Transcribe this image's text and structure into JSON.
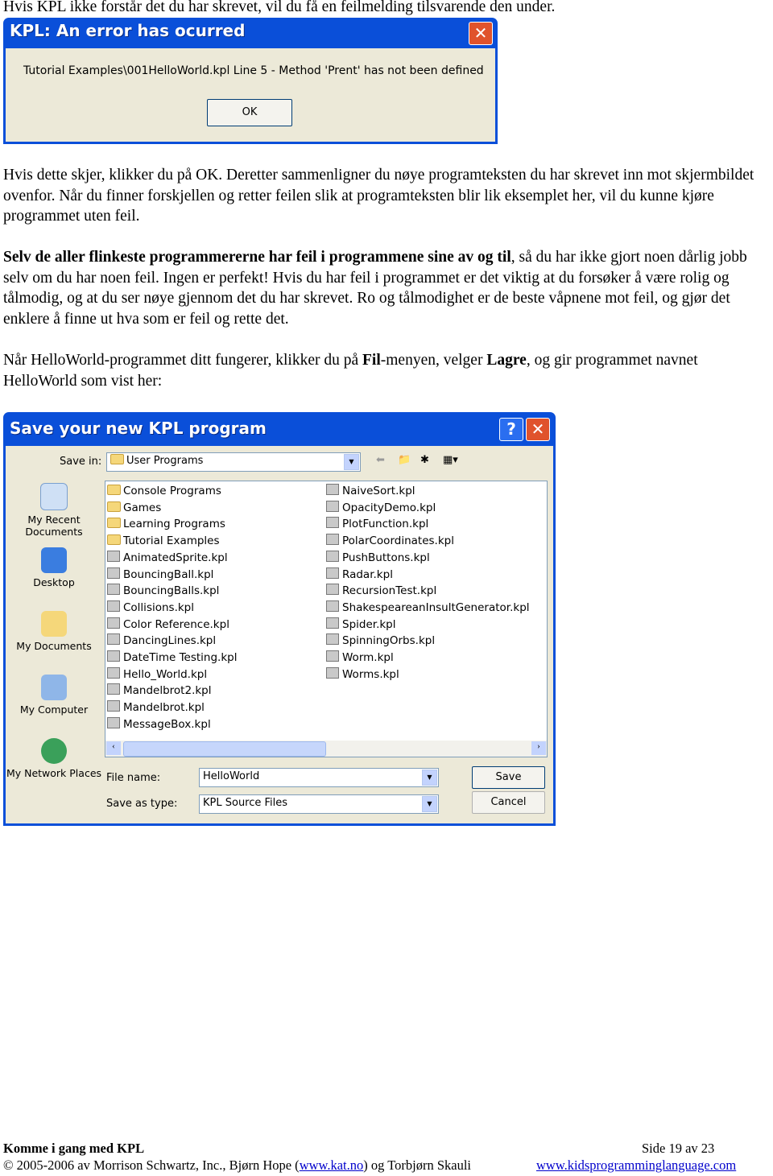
{
  "intro": "Hvis KPL ikke forstår det du har skrevet, vil du få en feilmelding tilsvarende den under.",
  "error_dialog": {
    "title": "KPL: An error has ocurred",
    "message": "Tutorial Examples\\001HelloWorld.kpl Line 5 - Method 'Prent' has not been defined",
    "ok": "OK",
    "close_icon": "close-icon"
  },
  "para1": "Hvis dette skjer, klikker du på OK. Deretter sammenligner du nøye programteksten du har skrevet inn mot skjermbildet ovenfor. Når du finner forskjellen og retter feilen slik at programteksten blir lik eksemplet her, vil du kunne kjøre programmet uten feil.",
  "para2": {
    "bold": "Selv de aller flinkeste programmererne har feil i programmene sine av og til",
    "rest": ", så du har ikke gjort noen dårlig jobb selv om du har noen feil. Ingen er perfekt! Hvis du har feil i programmet er det viktig at du forsøker å være rolig og tålmodig, og at du ser nøye gjennom det du har skrevet. Ro og tålmodighet er de beste våpnene mot feil, og gjør det enklere å finne ut hva som er feil og rette det."
  },
  "para3": {
    "t1": "Når HelloWorld-programmet ditt fungerer, klikker du på ",
    "b1": "Fil",
    "t2": "-menyen, velger ",
    "b2": "Lagre",
    "t3": ", og gir programmet navnet HelloWorld som vist her:"
  },
  "save_dialog": {
    "title": "Save your new KPL program",
    "save_in_label": "Save in:",
    "save_in_value": "User Programs",
    "places": [
      "My Recent Documents",
      "Desktop",
      "My Documents",
      "My Computer",
      "My Network Places"
    ],
    "folders": [
      "Console Programs",
      "Games",
      "Learning Programs",
      "Tutorial Examples"
    ],
    "files_col1": [
      "AnimatedSprite.kpl",
      "BouncingBall.kpl",
      "BouncingBalls.kpl",
      "Collisions.kpl",
      "Color Reference.kpl",
      "DancingLines.kpl",
      "DateTime Testing.kpl",
      "Hello_World.kpl",
      "Mandelbrot2.kpl",
      "Mandelbrot.kpl",
      "MessageBox.kpl"
    ],
    "files_col2": [
      "NaiveSort.kpl",
      "OpacityDemo.kpl",
      "PlotFunction.kpl",
      "PolarCoordinates.kpl",
      "PushButtons.kpl",
      "Radar.kpl",
      "RecursionTest.kpl",
      "ShakespeareanInsultGenerator.kpl",
      "Spider.kpl",
      "SpinningOrbs.kpl",
      "Worm.kpl",
      "Worms.kpl"
    ],
    "file_name_label": "File name:",
    "file_name_value": "HelloWorld",
    "type_label": "Save as type:",
    "type_value": "KPL Source Files",
    "save": "Save",
    "cancel": "Cancel",
    "help": "?",
    "close": "X"
  },
  "footer": {
    "title": "Komme i gang med KPL",
    "page": "Side 19 av 23",
    "copy1": "© 2005-2006 av Morrison Schwartz, Inc., Bjørn Hope (",
    "link1": "www.kat.no",
    "copy2": ") og Torbjørn Skauli",
    "link2": "www.kidsprogramminglanguage.com"
  },
  "colors": {
    "titlebar": "#0a4fd9",
    "dialog_bg": "#ece9d8",
    "close": "#e0532c"
  }
}
